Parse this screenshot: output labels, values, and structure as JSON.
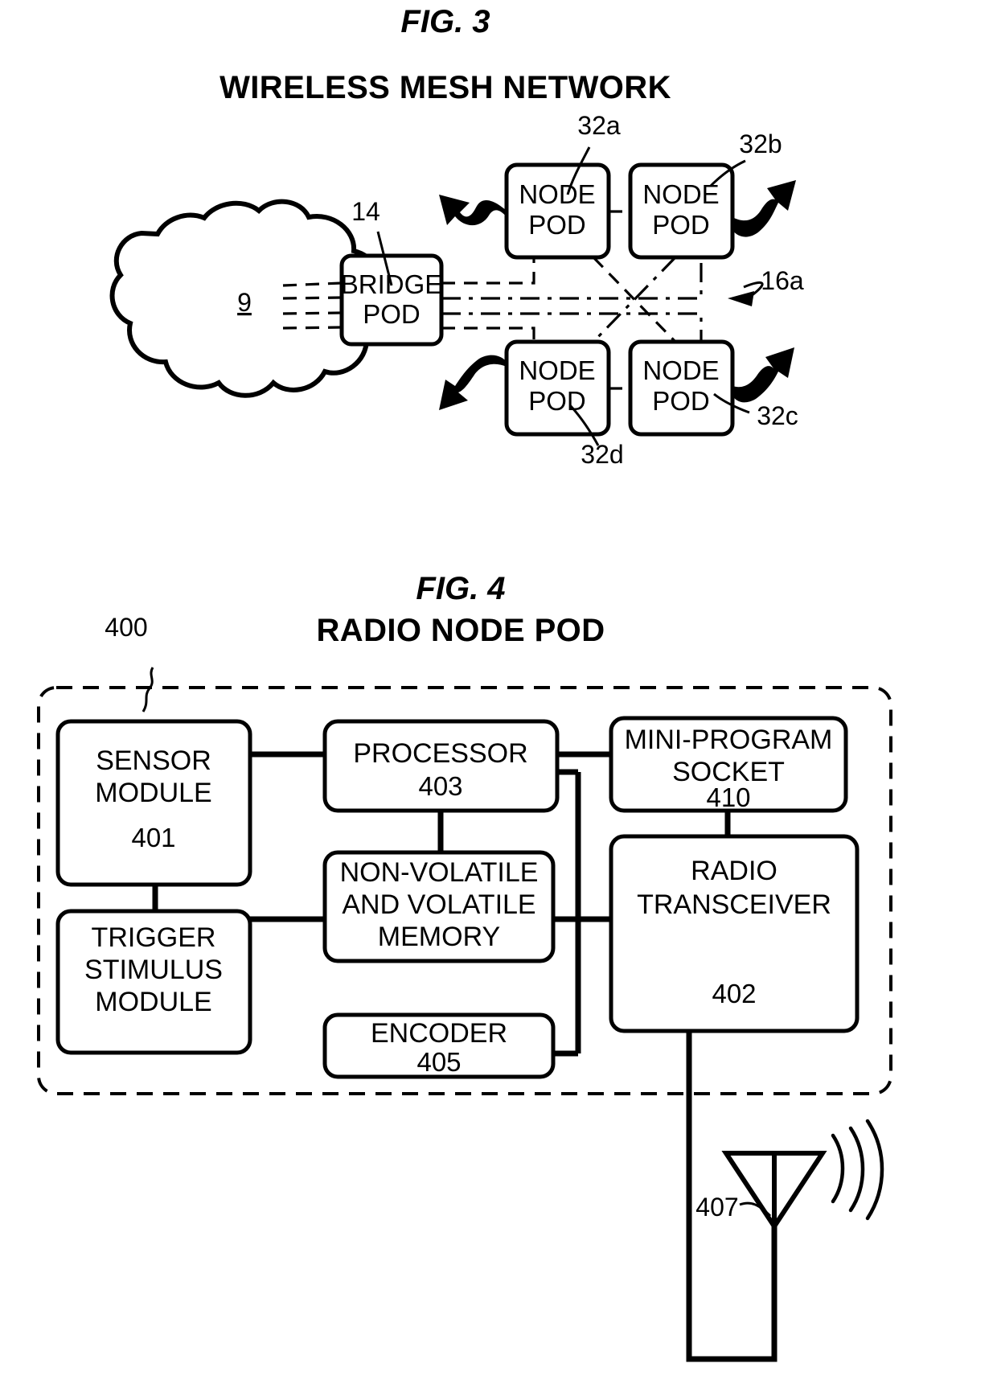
{
  "figures": [
    {
      "id": "fig3",
      "title": "FIG. 3",
      "subtitle": "WIRELESS MESH NETWORK",
      "cloud": {
        "label": "9"
      },
      "bridge": {
        "line1": "BRIDGE",
        "line2": "POD",
        "ref": "14"
      },
      "mesh_ref": "16a",
      "nodes": [
        {
          "line1": "NODE",
          "line2": "POD",
          "ref": "32a"
        },
        {
          "line1": "NODE",
          "line2": "POD",
          "ref": "32b"
        },
        {
          "line1": "NODE",
          "line2": "POD",
          "ref": "32c"
        },
        {
          "line1": "NODE",
          "line2": "POD",
          "ref": "32d"
        }
      ]
    },
    {
      "id": "fig4",
      "title": "FIG. 4",
      "subtitle": "RADIO NODE POD",
      "enclosure_ref": "400",
      "blocks": [
        {
          "name": "sensor-module",
          "lines": [
            "SENSOR",
            "MODULE"
          ],
          "ref": "401"
        },
        {
          "name": "trigger-stimulus-module",
          "lines": [
            "TRIGGER",
            "STIMULUS",
            "MODULE"
          ],
          "ref": ""
        },
        {
          "name": "processor",
          "lines": [
            "PROCESSOR"
          ],
          "ref": "403"
        },
        {
          "name": "memory",
          "lines": [
            "NON-VOLATILE",
            "AND VOLATILE",
            "MEMORY"
          ],
          "ref": ""
        },
        {
          "name": "encoder",
          "lines": [
            "ENCODER"
          ],
          "ref": "405"
        },
        {
          "name": "mini-program-socket",
          "lines": [
            "MINI-PROGRAM",
            "SOCKET"
          ],
          "ref": "410"
        },
        {
          "name": "radio-transceiver",
          "lines": [
            "RADIO",
            "TRANSCEIVER"
          ],
          "ref": "402"
        }
      ],
      "antenna_ref": "407"
    }
  ]
}
